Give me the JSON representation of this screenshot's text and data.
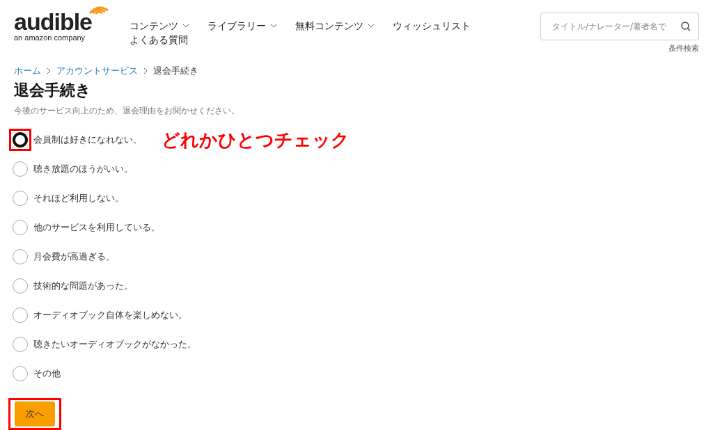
{
  "logo": {
    "wordmark": "audible",
    "tagline": "an amazon company"
  },
  "nav": [
    {
      "label": "コンテンツ",
      "dropdown": true
    },
    {
      "label": "ライブラリー",
      "dropdown": true
    },
    {
      "label": "無料コンテンツ",
      "dropdown": true
    },
    {
      "label": "ウィッシュリスト",
      "dropdown": false
    },
    {
      "label": "よくある質問",
      "dropdown": false
    }
  ],
  "search": {
    "placeholder": "タイトル/ナレーター/著者名で",
    "advanced_link": "条件検索"
  },
  "breadcrumb": [
    {
      "label": "ホーム",
      "link": true
    },
    {
      "label": "アカウントサービス",
      "link": true
    },
    {
      "label": "退会手続き",
      "link": false
    }
  ],
  "title": "退会手続き",
  "subtitle": "今後のサービス向上のため、退会理由をお聞かせください。",
  "reasons": [
    {
      "label": "会員制は好きになれない。",
      "selected": true,
      "highlighted": true
    },
    {
      "label": "聴き放題のほうがいい。",
      "selected": false,
      "highlighted": false
    },
    {
      "label": "それほど利用しない。",
      "selected": false,
      "highlighted": false
    },
    {
      "label": "他のサービスを利用している。",
      "selected": false,
      "highlighted": false
    },
    {
      "label": "月会費が高過ぎる。",
      "selected": false,
      "highlighted": false
    },
    {
      "label": "技術的な問題があった。",
      "selected": false,
      "highlighted": false
    },
    {
      "label": "オーディオブック自体を楽しめない。",
      "selected": false,
      "highlighted": false
    },
    {
      "label": "聴きたいオーディオブックがなかった。",
      "selected": false,
      "highlighted": false
    },
    {
      "label": "その他",
      "selected": false,
      "highlighted": false
    }
  ],
  "annotation": "どれかひとつチェック",
  "next_button": {
    "label": "次へ",
    "highlighted": true
  }
}
